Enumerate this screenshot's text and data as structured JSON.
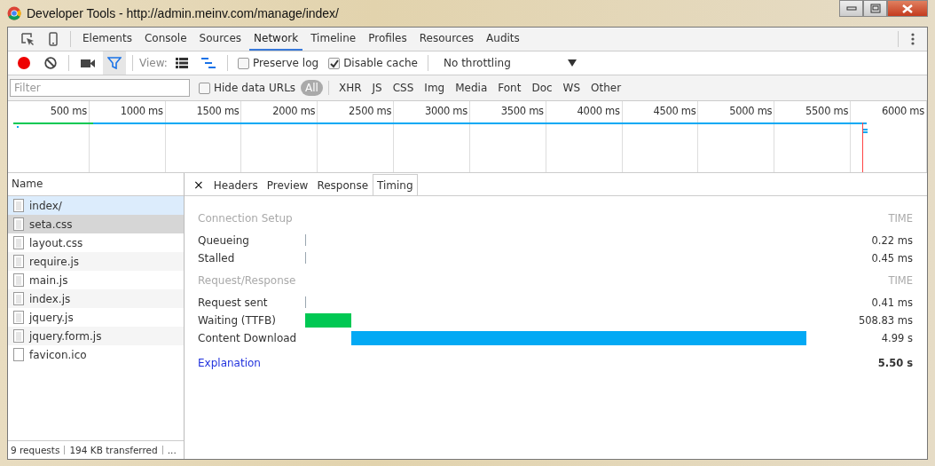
{
  "window": {
    "title": "Developer Tools - http://admin.meinv.com/manage/index/"
  },
  "panel_tabs": [
    {
      "label": "Elements",
      "selected": false
    },
    {
      "label": "Console",
      "selected": false
    },
    {
      "label": "Sources",
      "selected": false
    },
    {
      "label": "Network",
      "selected": true
    },
    {
      "label": "Timeline",
      "selected": false
    },
    {
      "label": "Profiles",
      "selected": false
    },
    {
      "label": "Resources",
      "selected": false
    },
    {
      "label": "Audits",
      "selected": false
    }
  ],
  "toolbar": {
    "recording": true,
    "filter_on": true,
    "view_label": "View:",
    "preserve_log": {
      "label": "Preserve log",
      "checked": false
    },
    "disable_cache": {
      "label": "Disable cache",
      "checked": true
    },
    "throttling": "No throttling"
  },
  "filter_bar": {
    "placeholder": "Filter",
    "hide_data_urls": {
      "label": "Hide data URLs",
      "checked": false
    },
    "types": [
      {
        "label": "All",
        "selected": true
      },
      {
        "label": "XHR",
        "selected": false
      },
      {
        "label": "JS",
        "selected": false
      },
      {
        "label": "CSS",
        "selected": false
      },
      {
        "label": "Img",
        "selected": false
      },
      {
        "label": "Media",
        "selected": false
      },
      {
        "label": "Font",
        "selected": false
      },
      {
        "label": "Doc",
        "selected": false
      },
      {
        "label": "WS",
        "selected": false
      },
      {
        "label": "Other",
        "selected": false
      }
    ]
  },
  "overview": {
    "ticks": [
      "500 ms",
      "1000 ms",
      "1500 ms",
      "2000 ms",
      "2500 ms",
      "3000 ms",
      "3500 ms",
      "4000 ms",
      "4500 ms",
      "5000 ms",
      "5500 ms",
      "6000 ms"
    ]
  },
  "requests": {
    "header": "Name",
    "items": [
      {
        "name": "index/",
        "kind": "doc",
        "selected": true,
        "highlighted": false
      },
      {
        "name": "seta.css",
        "kind": "doc",
        "selected": false,
        "highlighted": true
      },
      {
        "name": "layout.css",
        "kind": "doc",
        "selected": false,
        "highlighted": false
      },
      {
        "name": "require.js",
        "kind": "doc",
        "selected": false,
        "highlighted": false
      },
      {
        "name": "main.js",
        "kind": "doc",
        "selected": false,
        "highlighted": false
      },
      {
        "name": "index.js",
        "kind": "doc",
        "selected": false,
        "highlighted": false
      },
      {
        "name": "jquery.js",
        "kind": "doc",
        "selected": false,
        "highlighted": false
      },
      {
        "name": "jquery.form.js",
        "kind": "doc",
        "selected": false,
        "highlighted": false
      },
      {
        "name": "favicon.ico",
        "kind": "blank",
        "selected": false,
        "highlighted": false
      }
    ],
    "status": [
      "9 requests",
      "194 KB transferred",
      "..."
    ]
  },
  "detail": {
    "close": "×",
    "tabs": [
      {
        "label": "Headers",
        "selected": false
      },
      {
        "label": "Preview",
        "selected": false
      },
      {
        "label": "Response",
        "selected": false
      },
      {
        "label": "Timing",
        "selected": true
      }
    ],
    "sections": [
      {
        "title": "Connection Setup",
        "time_header": "TIME",
        "phases": [
          {
            "label": "Queueing",
            "kind": "tick",
            "time": "0.22 ms"
          },
          {
            "label": "Stalled",
            "kind": "tick",
            "time": "0.45 ms"
          }
        ]
      },
      {
        "title": "Request/Response",
        "time_header": "TIME",
        "phases": [
          {
            "label": "Request sent",
            "kind": "tick",
            "time": "0.41 ms"
          },
          {
            "label": "Waiting (TTFB)",
            "kind": "waiting",
            "time": "508.83 ms"
          },
          {
            "label": "Content Download",
            "kind": "download",
            "time": "4.99 s"
          }
        ]
      }
    ],
    "explanation": "Explanation",
    "total": "5.50 s"
  }
}
